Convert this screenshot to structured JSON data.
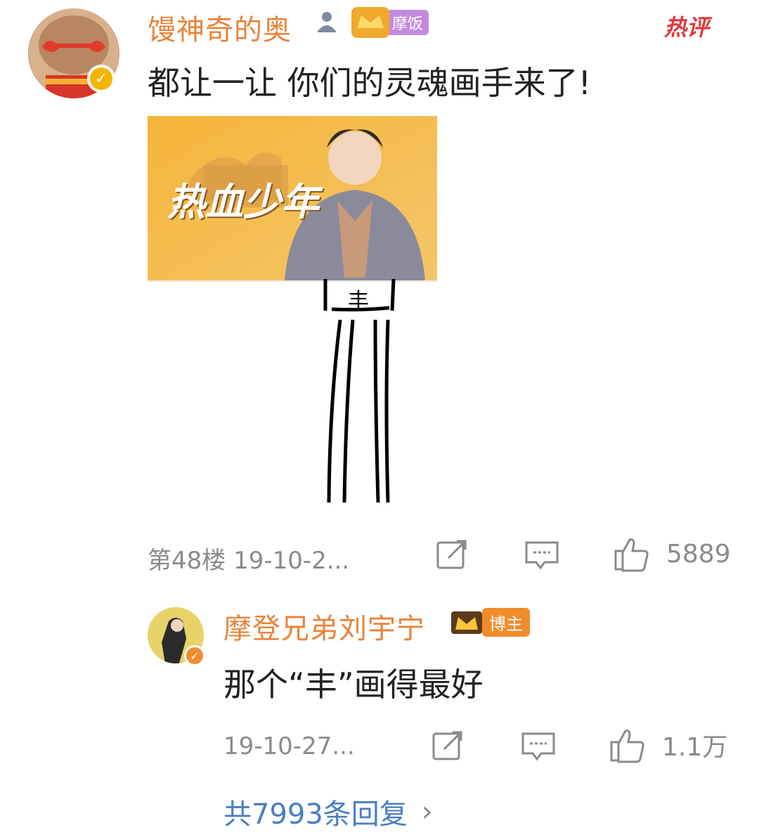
{
  "comment": {
    "username": "馒神奇的奥",
    "badge": "摩饭",
    "hot_label": "热评",
    "text": "都让一让 你们的灵魂画手来了!",
    "banner": {
      "title": "热血少年"
    },
    "drawing": {
      "sign_char": "丰"
    },
    "floor_time": "第48楼 19-10-2...",
    "like_count": "5889"
  },
  "reply": {
    "username": "摩登兄弟刘宇宁",
    "badge": "博主",
    "text": "那个“丰”画得最好",
    "time": "19-10-27...",
    "like_count": "1.1万"
  },
  "more_replies": "共7993条回复",
  "colors": {
    "username": "#e8833a",
    "hot": "#e0383e",
    "link": "#4a7fc0",
    "icon": "#8a8a8a",
    "vip_badge": "#ffb400"
  }
}
